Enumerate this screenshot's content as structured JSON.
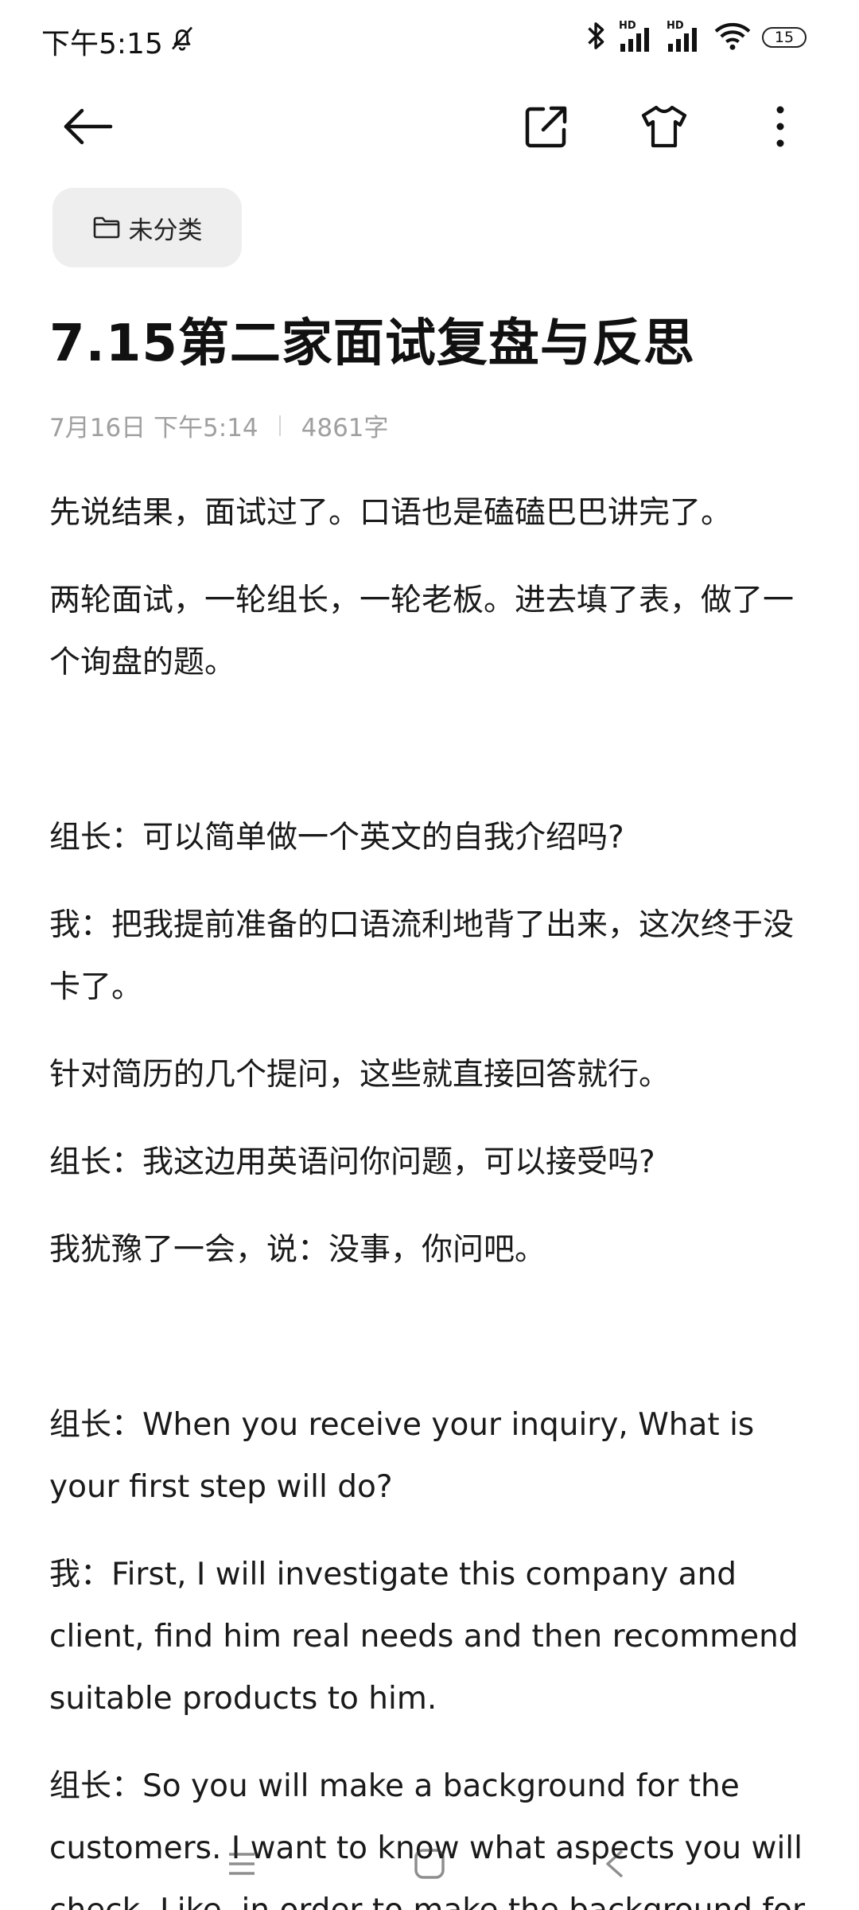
{
  "status_bar": {
    "time": "下午5:15",
    "battery": "15",
    "icons": [
      "mute-bell-icon",
      "bluetooth-icon",
      "hd-signal-icon",
      "hd-signal-icon",
      "wifi-icon",
      "battery-icon"
    ],
    "hd_label": "HD"
  },
  "app_bar": {
    "icons": [
      "back-arrow-icon",
      "share-external-icon",
      "theme-shirt-icon",
      "more-vertical-icon"
    ]
  },
  "category": {
    "label": "未分类",
    "icon": "folder-icon"
  },
  "note": {
    "title": "7.15第二家面试复盘与反思",
    "date": "7月16日 下午5:14",
    "word_count": "4861字",
    "paragraphs": [
      "先说结果，面试过了。口语也是磕磕巴巴讲完了。",
      "两轮面试，一轮组长，一轮老板。进去填了表，做了一个询盘的题。",
      "",
      "组长：可以简单做一个英文的自我介绍吗?",
      "我：把我提前准备的口语流利地背了出来，这次终于没卡了。",
      "针对简历的几个提问，这些就直接回答就行。",
      "组长：我这边用英语问你问题，可以接受吗?",
      "我犹豫了一会，说：没事，你问吧。",
      "",
      "组长：When you receive your inquiry, What is your first step will do?",
      "我：First, I will investigate this company and client, find him real needs and then recommend suitable products to him.",
      "组长：So you will make a background for the customers. I want to know what aspects you will check. Like, in order to make the background for"
    ]
  }
}
